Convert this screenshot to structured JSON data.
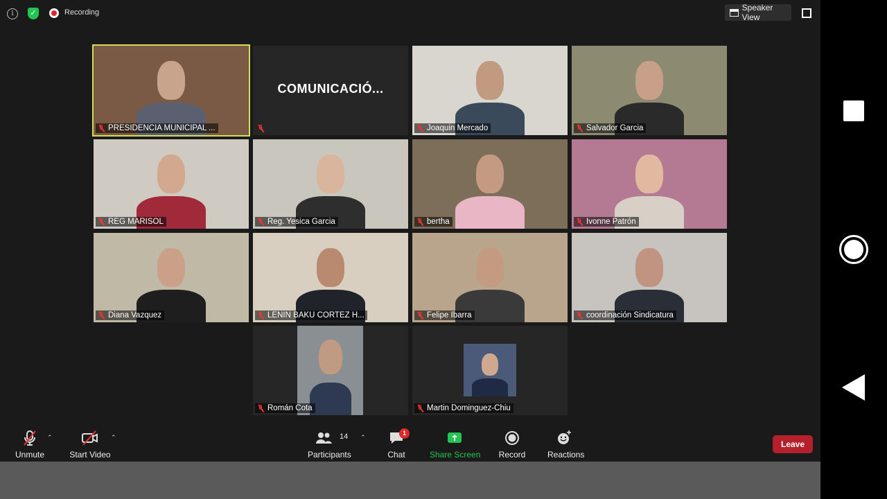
{
  "top_bar": {
    "recording_label": "Recording",
    "speaker_view_label": "Speaker View"
  },
  "tiles": [
    {
      "name": "PRESIDENCIA MUNICIPAL ...",
      "display_name": "",
      "bg": "#7a5a45",
      "active": true
    },
    {
      "name": "",
      "display_name": "COMUNICACIÓ...",
      "bg": "#262626"
    },
    {
      "name": "Joaquin Mercado",
      "display_name": "",
      "bg": "#d9d6d0"
    },
    {
      "name": "Salvador Garcia",
      "display_name": "",
      "bg": "#8c8a70"
    },
    {
      "name": "REG MARISOL",
      "display_name": "",
      "bg": "#cfcac2"
    },
    {
      "name": "Reg. Yesica Garcia",
      "display_name": "",
      "bg": "#c9c6bd"
    },
    {
      "name": "bertha",
      "display_name": "",
      "bg": "#7d6e5a"
    },
    {
      "name": "Ivonne Patrón",
      "display_name": "",
      "bg": "#b57a93"
    },
    {
      "name": "Diana Vazquez",
      "display_name": "",
      "bg": "#bfb9a5"
    },
    {
      "name": "LENIN BAKU CORTEZ H...",
      "display_name": "",
      "bg": "#d8cfc0"
    },
    {
      "name": "Felipe Ibarra",
      "display_name": "",
      "bg": "#b9a48c"
    },
    {
      "name": "coordinación Sindicatura",
      "display_name": "",
      "bg": "#c7c4c0"
    },
    {
      "name": "Román Cota",
      "display_name": "",
      "bg": "#262626"
    },
    {
      "name": "Martin Dominguez-Chiu",
      "display_name": "",
      "bg": "#262626"
    }
  ],
  "toolbar": {
    "unmute": "Unmute",
    "start_video": "Start Video",
    "participants": "Participants",
    "participant_count": "14",
    "chat": "Chat",
    "chat_badge": "1",
    "share_screen": "Share Screen",
    "record": "Record",
    "reactions": "Reactions",
    "leave": "Leave"
  },
  "colors": {
    "active_speaker": "#d4e157",
    "share_green": "#23c552",
    "leave_red": "#b5202c",
    "mute_red": "#e33333"
  }
}
